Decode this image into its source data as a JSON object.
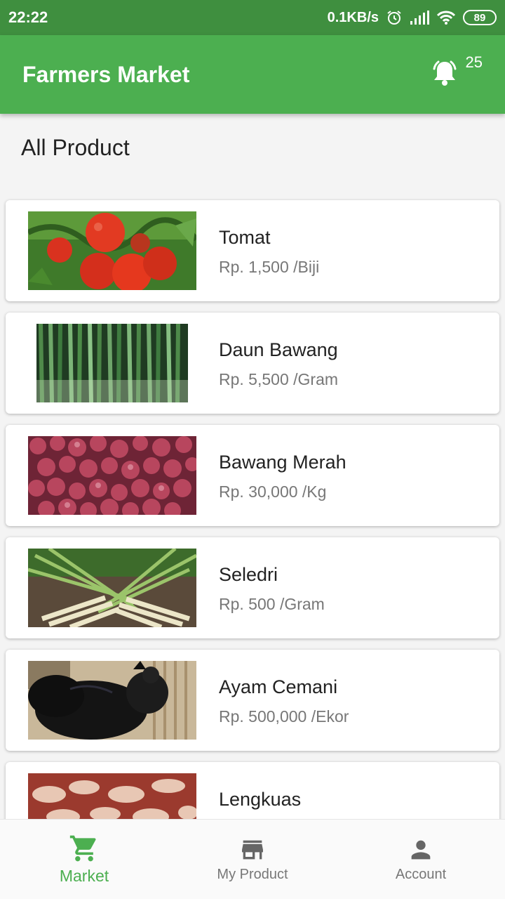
{
  "status_bar": {
    "time": "22:22",
    "network_speed": "0.1KB/s",
    "battery": "89",
    "icons": [
      "alarm-icon",
      "signal-icon",
      "wifi-icon",
      "battery-icon"
    ]
  },
  "app_bar": {
    "title": "Farmers Market",
    "notification_icon": "bell-ringing-icon",
    "notification_count": "25"
  },
  "section": {
    "title": "All Product"
  },
  "products": [
    {
      "name": "Tomat",
      "price": "Rp. 1,500 /Biji",
      "image": "tomato-photo"
    },
    {
      "name": "Daun Bawang",
      "price": "Rp. 5,500 /Gram",
      "image": "scallion-photo"
    },
    {
      "name": "Bawang Merah",
      "price": "Rp. 30,000 /Kg",
      "image": "shallot-photo"
    },
    {
      "name": "Seledri",
      "price": "Rp. 500 /Gram",
      "image": "lemongrass-photo"
    },
    {
      "name": "Ayam Cemani",
      "price": "Rp. 500,000 /Ekor",
      "image": "black-chicken-photo"
    },
    {
      "name": "Lengkuas",
      "price": "",
      "image": "galangal-photo"
    }
  ],
  "bottom_nav": [
    {
      "label": "Market",
      "icon": "cart-icon",
      "active": true
    },
    {
      "label": "My Product",
      "icon": "store-icon",
      "active": false
    },
    {
      "label": "Account",
      "icon": "person-icon",
      "active": false
    }
  ],
  "colors": {
    "primary": "#4caf50",
    "status_bar": "#3f8f3f",
    "inactive": "#777777"
  }
}
